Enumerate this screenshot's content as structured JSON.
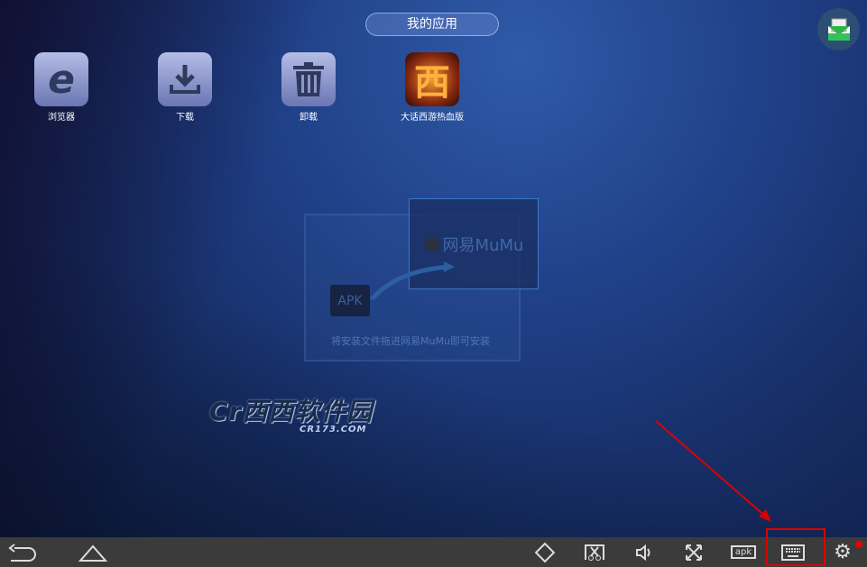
{
  "header": {
    "title": "我的应用"
  },
  "apps": [
    {
      "label": "浏览器",
      "icon": "ie-browser-icon"
    },
    {
      "label": "下载",
      "icon": "download-icon"
    },
    {
      "label": "卸载",
      "icon": "trash-icon"
    },
    {
      "label": "大话西游热血版",
      "icon": "game-icon"
    }
  ],
  "dropzone": {
    "brand": "网易MuMu",
    "apk": "APK",
    "hint": "将安装文件拖进网易MuMu即可安装"
  },
  "watermark": {
    "text": "Cr西西软件园",
    "sub": "CR173.COM"
  },
  "toolbar": {
    "apk_label": "apk"
  },
  "colors": {
    "highlight": "#dd0000",
    "bar": "#3b3b3b"
  }
}
